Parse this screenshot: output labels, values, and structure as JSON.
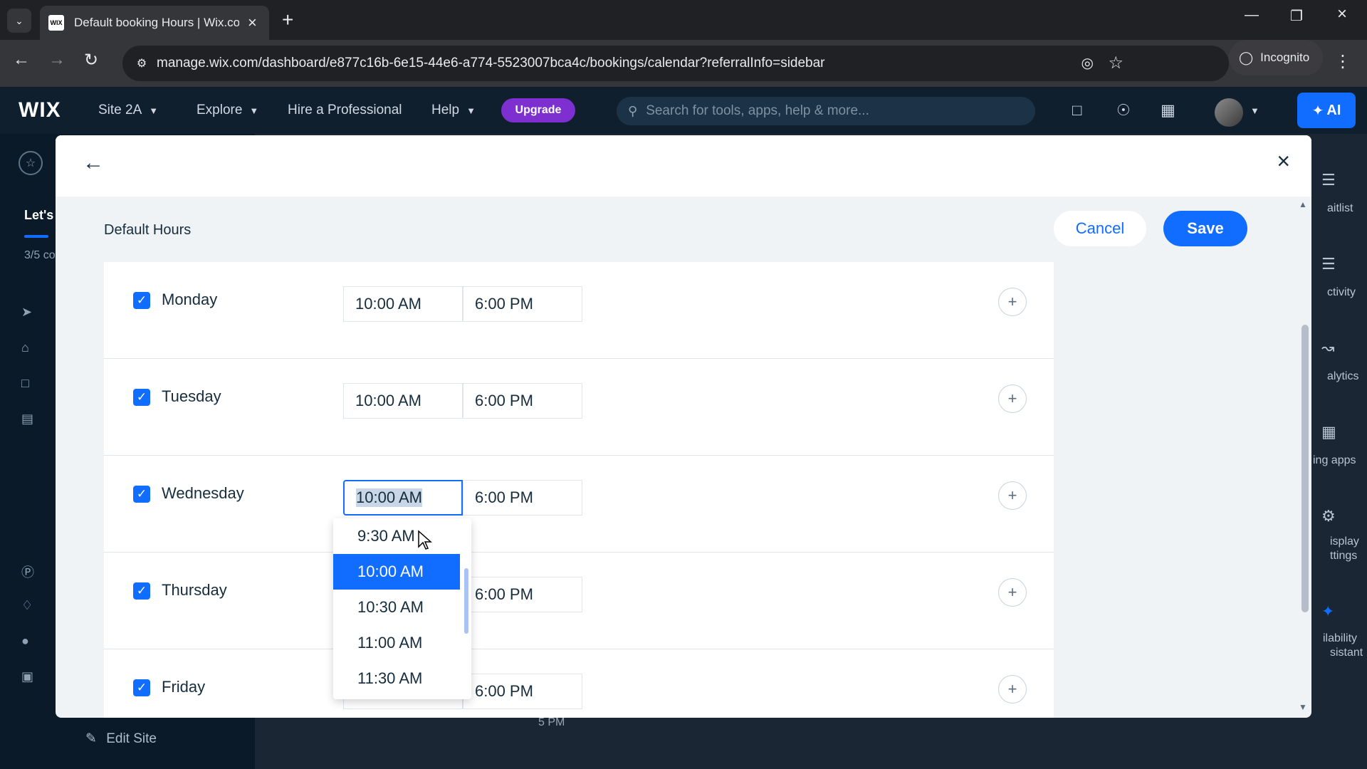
{
  "browser": {
    "tab_title": "Default booking Hours | Wix.co",
    "favicon": "WIX",
    "url": "manage.wix.com/dashboard/e877c16b-6e15-44e6-a774-5523007bca4c/bookings/calendar?referralInfo=sidebar",
    "incognito_label": "Incognito"
  },
  "wix_header": {
    "logo": "WIX",
    "site_name": "Site 2A",
    "explore": "Explore",
    "hire": "Hire a Professional",
    "help": "Help",
    "upgrade": "Upgrade",
    "search_placeholder": "Search for tools, apps, help & more...",
    "ai_label": "AI"
  },
  "background": {
    "left_rail_partial": [
      "Let's",
      "3/5 co"
    ],
    "edit_site": "Edit Site",
    "calendar_time": "5 PM",
    "right_rail_partial": [
      "aitlist",
      "ctivity",
      "alytics",
      "ing apps",
      "isplay",
      "ttings",
      "ilability",
      "sistant"
    ]
  },
  "modal": {
    "section_title": "Default Hours",
    "cancel_label": "Cancel",
    "save_label": "Save",
    "days": [
      {
        "name": "Monday",
        "checked": true,
        "start": "10:00 AM",
        "end": "6:00 PM"
      },
      {
        "name": "Tuesday",
        "checked": true,
        "start": "10:00 AM",
        "end": "6:00 PM"
      },
      {
        "name": "Wednesday",
        "checked": true,
        "start": "10:00 AM",
        "end": "6:00 PM"
      },
      {
        "name": "Thursday",
        "checked": true,
        "start": "",
        "end": "6:00 PM"
      },
      {
        "name": "Friday",
        "checked": true,
        "start": "",
        "end": "6:00 PM"
      }
    ],
    "dropdown_options": [
      "9:30 AM",
      "10:00 AM",
      "10:30 AM",
      "11:00 AM",
      "11:30 AM"
    ],
    "dropdown_selected": "10:00 AM"
  },
  "colors": {
    "accent": "#116dff",
    "upgrade": "#7d2fd0",
    "text": "#162d3d"
  }
}
